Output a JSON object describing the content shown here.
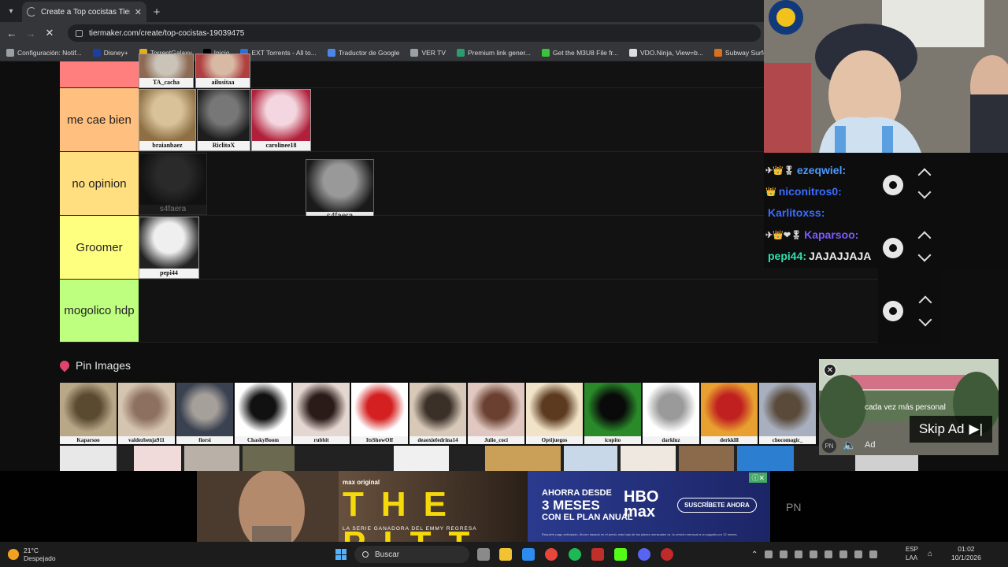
{
  "browser": {
    "tab_title": "Create a Top cocistas Tier List",
    "tab_close": "✕",
    "new_tab": "+",
    "url": "tiermaker.com/create/top-cocistas-19039475",
    "bookmarks": [
      {
        "label": "Configuración: Notif...",
        "icon": "gear-icon",
        "color": "#9aa0a6"
      },
      {
        "label": "Disney+",
        "icon": "disney-icon",
        "color": "#1a3fa0"
      },
      {
        "label": "TorrentGalaxy",
        "icon": "torrentgalaxy-icon",
        "color": "#e0b020"
      },
      {
        "label": "Inicio",
        "icon": "x-logo-icon",
        "color": "#000000"
      },
      {
        "label": "EXT Torrents - All to...",
        "icon": "ext-icon",
        "color": "#2f6fd1"
      },
      {
        "label": "Traductor de Google",
        "icon": "translate-icon",
        "color": "#4a86e8"
      },
      {
        "label": "VER TV",
        "icon": "folder-icon",
        "color": "#9aa0a6"
      },
      {
        "label": "Premium link gener...",
        "icon": "link-icon",
        "color": "#2a9d6f"
      },
      {
        "label": "Get the M3U8 File fr...",
        "icon": "m3u8-icon",
        "color": "#3cc33c"
      },
      {
        "label": "VDO.Ninja, View=b...",
        "icon": "vdo-ninja-icon",
        "color": "#dddddd"
      },
      {
        "label": "Subway Surfers Web",
        "icon": "subway-surfers-icon",
        "color": "#d9701d"
      }
    ]
  },
  "tiers": [
    {
      "label": "",
      "color": "#ff7f7f",
      "items": [
        {
          "caption": "TA_cacha",
          "colors": [
            "#c9c3b8",
            "#8e6a52"
          ]
        },
        {
          "caption": "ailusitaa",
          "colors": [
            "#d8b9a4",
            "#b04040"
          ]
        }
      ]
    },
    {
      "label": "me cae bien",
      "color": "#ffbf7f",
      "items": [
        {
          "caption": "braianbaez",
          "colors": [
            "#d9c29a",
            "#8d6f43"
          ]
        },
        {
          "caption": "RiclitoX",
          "colors": [
            "#777777",
            "#1d1d1d"
          ]
        },
        {
          "caption": "carolinee18",
          "colors": [
            "#f3d6df",
            "#b0203a"
          ]
        }
      ]
    },
    {
      "label": "no opinion",
      "color": "#ffdf7f",
      "items": [
        {
          "caption": "s4faera",
          "colors": [
            "#2a2a2a",
            "#111111"
          ],
          "style": "dark"
        },
        {
          "caption": "s4faera",
          "colors": [
            "#999999",
            "#1a1a1a"
          ],
          "style": "selected"
        }
      ]
    },
    {
      "label": "Groomer",
      "color": "#ffff7f",
      "items": [
        {
          "caption": "pepi44",
          "colors": [
            "#efefef",
            "#222222"
          ]
        }
      ]
    },
    {
      "label": "mogolico hdp",
      "color": "#bfff7f",
      "items": []
    }
  ],
  "pins": {
    "title": "Pin Images",
    "items": [
      {
        "caption": "Kaparsoo",
        "colors": [
          "#b9a888",
          "#5a4a30"
        ]
      },
      {
        "caption": "valdezbenja911",
        "colors": [
          "#d5c4b0",
          "#8d7060"
        ]
      },
      {
        "caption": "fiorsi",
        "colors": [
          "#3a4150",
          "#a6a09a"
        ]
      },
      {
        "caption": "ChaskyBoom",
        "colors": [
          "#ffffff",
          "#111111"
        ]
      },
      {
        "caption": "rubbit",
        "colors": [
          "#e4d6d0",
          "#2a1a18"
        ]
      },
      {
        "caption": "ItsShowOff",
        "colors": [
          "#ffffff",
          "#d42020"
        ]
      },
      {
        "caption": "deaoxiefedrina14",
        "colors": [
          "#d8c8b8",
          "#3a3028"
        ]
      },
      {
        "caption": "Julio_coci",
        "colors": [
          "#e0c8c0",
          "#6a4030"
        ]
      },
      {
        "caption": "Optijuegos",
        "colors": [
          "#f1e3c8",
          "#5b3a1f"
        ]
      },
      {
        "caption": "icopito",
        "colors": [
          "#2a8a2a",
          "#0a0a0a"
        ]
      },
      {
        "caption": "darkluz",
        "colors": [
          "#ffffff",
          "#9a9a9a"
        ]
      },
      {
        "caption": "derkklll",
        "colors": [
          "#e8a030",
          "#c02020"
        ]
      },
      {
        "caption": "chocomagic_",
        "colors": [
          "#a8b0c0",
          "#5a4a3a"
        ]
      }
    ]
  },
  "chat": {
    "messages": [
      {
        "user": "ezeqwiel:",
        "user_color": "#4a9bff",
        "badges": "✈👑🎖",
        "text": ""
      },
      {
        "user": "niconitros0:",
        "user_color": "#3b6dff",
        "badges": "👑",
        "text": ""
      },
      {
        "user": "Karlitoxss:",
        "user_color": "#3b6dff",
        "badges": "",
        "text": ""
      },
      {
        "user": "Kaparsoo:",
        "user_color": "#7a5bff",
        "badges": "✈👑❤🎖",
        "text": ""
      },
      {
        "user": "pepi44:",
        "user_color": "#2fe0b0",
        "badges": "",
        "text": "JAJAJJAJA"
      }
    ]
  },
  "video_ad": {
    "subtitle": "cada vez más personal",
    "badge": "PN",
    "ad_label": "Ad",
    "skip_label": "Skip Ad"
  },
  "banner_ad": {
    "network": "max original",
    "title": "THE PITT",
    "tagline": "LA SERIE GANADORA DEL EMMY REGRESA",
    "promo_small": "AHORRA DESDE",
    "promo_big": "3 MESES",
    "promo_plan": "CON EL PLAN ANUAL",
    "brand_line1": "HBO",
    "brand_line2": "max",
    "cta": "SUSCRÍBETE AHORA",
    "fine_print": "Requiere pago anticipado. Ahorro basado en el precio más bajo de las planes mensuales vs. la versión mensual a un pagado por 12 meses."
  },
  "side_badge": "PN",
  "taskbar": {
    "temperature": "21°C",
    "weather": "Despejado",
    "search_placeholder": "Buscar",
    "language": "ESP",
    "layout": "LAA",
    "time": "01:02",
    "date": "10/1/2026"
  }
}
